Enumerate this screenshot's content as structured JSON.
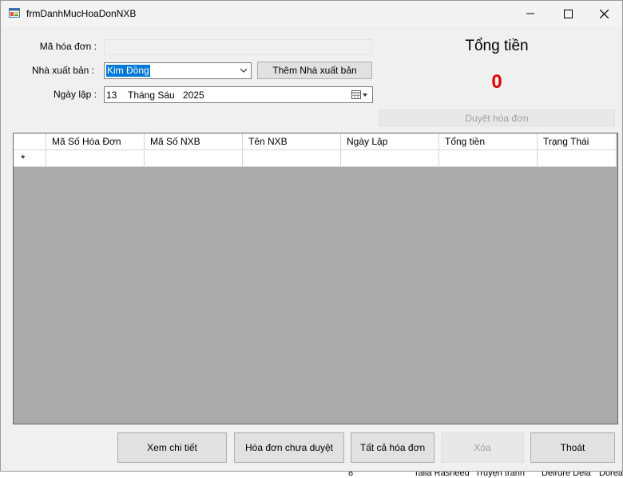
{
  "window": {
    "title": "frmDanhMucHoaDonNXB"
  },
  "form": {
    "ma_hoa_don_label": "Mã hóa đơn :",
    "ma_hoa_don_value": "",
    "nha_xuat_ban_label": "Nhà xuất bản :",
    "nha_xuat_ban_value": "Kim Đồng",
    "them_nxb_button": "Thêm Nhà xuất bản",
    "ngay_lap_label": "Ngày lập :",
    "date_day": "13",
    "date_month": "Tháng Sáu",
    "date_year": "2025",
    "tong_tien_label": "Tổng tiền",
    "tong_tien_value": "0",
    "duyet_button": "Duyệt hóa đơn"
  },
  "grid": {
    "columns": [
      "Mã Số Hóa Đơn",
      "Mã Số NXB",
      "Tên NXB",
      "Ngày Lập",
      "Tổng tiền",
      "Trạng Thái"
    ],
    "new_row_marker": "*"
  },
  "buttons": {
    "xem_chi_tiet": "Xem chi tiết",
    "chua_duyet": "Hóa đơn chưa duyệt",
    "tat_ca": "Tất cả hóa đơn",
    "xoa": "Xóa",
    "thoat": "Thoát"
  },
  "background_window": {
    "row_text": [
      "8",
      "Talia Rasheed",
      "Truyện tranh",
      "Deirdre Dela",
      "Dorea"
    ]
  },
  "colors": {
    "total_value": "#e00000",
    "grid_background": "#ababab",
    "selection": "#0078d7"
  }
}
